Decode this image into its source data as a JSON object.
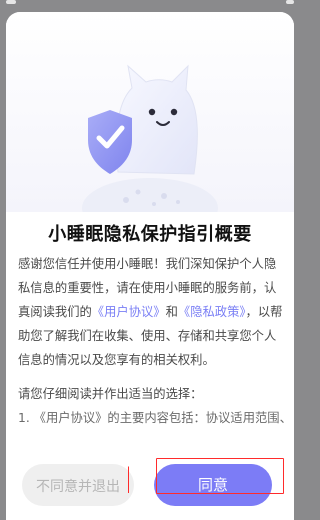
{
  "title": "小睡眠隐私保护指引概要",
  "body": {
    "part1": "感谢您信任并使用小睡眠！我们深知保护个人隐私信息的重要性，请在使用小睡眠的服务前，认真阅读我们的",
    "user_agreement_link": "《用户协议》",
    "and": "和",
    "privacy_policy_link": "《隐私政策》",
    "part2": "，以帮助您了解我们在收集、使用、存储和共享您个人信息的情况以及您享有的相关权利。",
    "instruction": "请您仔细阅读并作出适当的选择：",
    "item1": "1. 《用户协议》的主要内容包括：协议适用范围、"
  },
  "buttons": {
    "disagree": "不同意并退出",
    "agree": "同意"
  },
  "icons": {
    "mascot": "cat-mascot-icon",
    "shield": "shield-check-icon"
  },
  "colors": {
    "accent": "#7c7cf6",
    "link": "#7a7ff5",
    "highlight": "#ff2b2b"
  }
}
